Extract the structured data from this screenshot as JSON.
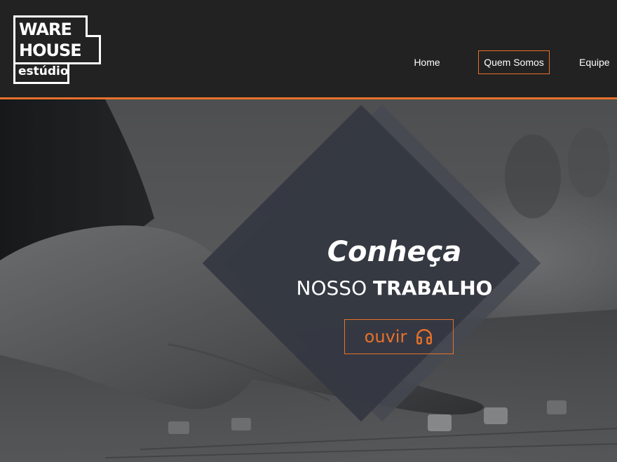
{
  "logo": {
    "line1": "WARE",
    "line2": "HOUSE",
    "sub": "estúdio"
  },
  "nav": {
    "items": [
      {
        "label": "Home"
      },
      {
        "label": "Quem Somos"
      },
      {
        "label": "Equipe"
      }
    ],
    "active_index": 1
  },
  "hero": {
    "title": "Conheça",
    "subtitle_light": "NOSSO",
    "subtitle_bold": "TRABALHO",
    "button_label": "ouvir",
    "button_icon": "headphones-icon"
  },
  "colors": {
    "accent": "#e8712a",
    "header_bg": "#222222",
    "diamond": "#343741",
    "text": "#ffffff"
  }
}
